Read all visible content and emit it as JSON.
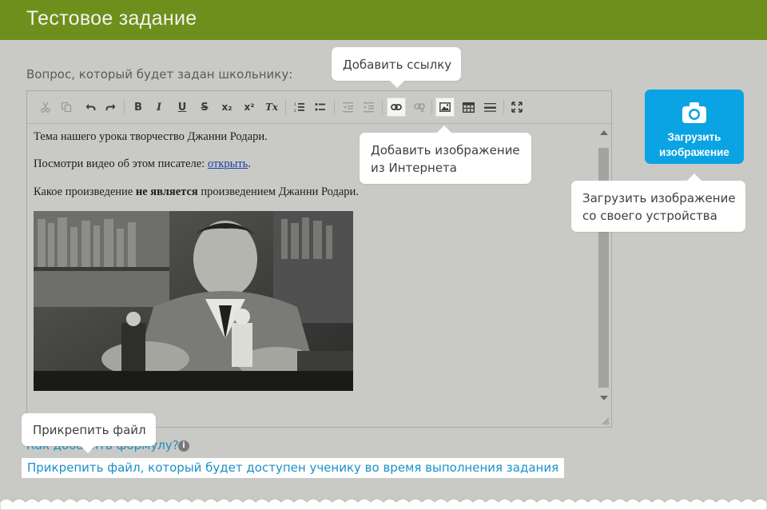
{
  "header": {
    "title": "Тестовое задание"
  },
  "question_label": "Вопрос, который будет задан школьнику:",
  "toolbar": {
    "buttons": [
      "cut",
      "copy",
      "undo",
      "redo",
      "bold",
      "italic",
      "underline",
      "strikethrough",
      "subscript",
      "superscript",
      "remove-format",
      "numbered-list",
      "bulleted-list",
      "outdent",
      "indent",
      "link",
      "unlink",
      "image",
      "table",
      "horizontal-line",
      "maximize"
    ],
    "bold_label": "B",
    "italic_label": "I",
    "underline_label": "U",
    "strike_label": "S",
    "sub_label": "x₂",
    "sup_label": "x²",
    "clear_label": "Tx"
  },
  "content": {
    "line1": "Тема нашего урока творчество Джанни Родари.",
    "line2_prefix": "Посмотри видео об этом писателе: ",
    "line2_link": "открыть",
    "line2_suffix": ".",
    "line3_prefix": "Какое произведение ",
    "line3_bold": "не является",
    "line3_suffix": " произведением Джанни Родари."
  },
  "tooltips": {
    "add_link": "Добавить ссылку",
    "add_image_line1": "Добавить изображение",
    "add_image_line2": "из Интернета",
    "upload_line1": "Загрузить изображение",
    "upload_line2": "со своего устройства",
    "attach_file": "Прикрепить файл"
  },
  "upload_button": {
    "line1": "Загрузить",
    "line2": "изображение"
  },
  "formula_link": "Как добавить формулу?",
  "info_icon_glyph": "i",
  "attach_link": "Прикрепить файл, который будет доступен ученику во время выполнения задания",
  "colors": {
    "header": "#6f8f1c",
    "accent_button": "#0aa3e3",
    "link": "#1b91c8",
    "background": "#c9c9c5"
  }
}
